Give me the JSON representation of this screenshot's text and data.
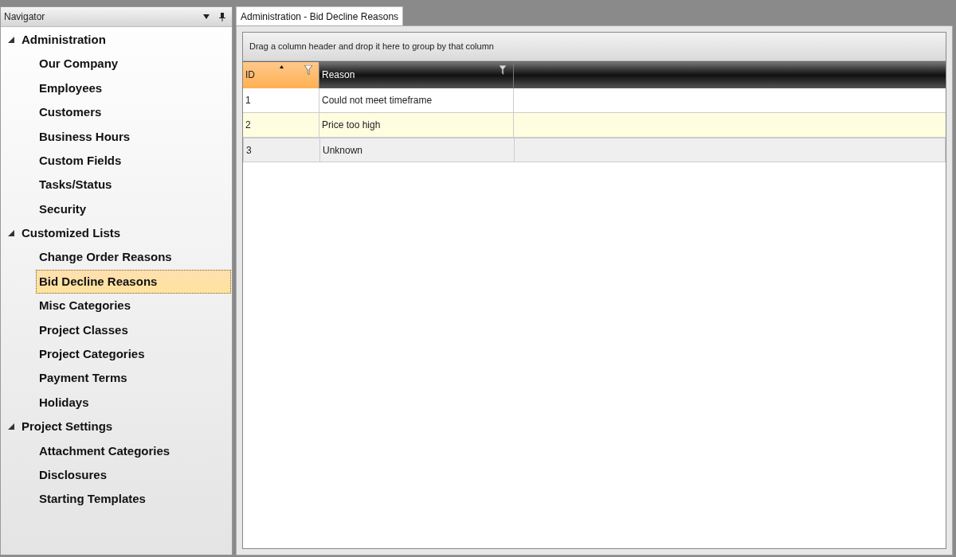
{
  "navigator": {
    "title": "Navigator",
    "groups": [
      {
        "label": "Administration",
        "expanded": true,
        "children": [
          {
            "label": "Our Company",
            "selected": false
          },
          {
            "label": "Employees",
            "selected": false
          },
          {
            "label": "Customers",
            "selected": false
          },
          {
            "label": "Business Hours",
            "selected": false
          },
          {
            "label": "Custom Fields",
            "selected": false
          },
          {
            "label": "Tasks/Status",
            "selected": false
          },
          {
            "label": "Security",
            "selected": false
          }
        ]
      },
      {
        "label": "Customized Lists",
        "expanded": true,
        "children": [
          {
            "label": "Change Order Reasons",
            "selected": false
          },
          {
            "label": "Bid Decline Reasons",
            "selected": true
          },
          {
            "label": "Misc Categories",
            "selected": false
          },
          {
            "label": "Project Classes",
            "selected": false
          },
          {
            "label": "Project Categories",
            "selected": false
          },
          {
            "label": "Payment Terms",
            "selected": false
          },
          {
            "label": "Holidays",
            "selected": false
          }
        ]
      },
      {
        "label": "Project Settings",
        "expanded": true,
        "children": [
          {
            "label": "Attachment Categories",
            "selected": false
          },
          {
            "label": "Disclosures",
            "selected": false
          },
          {
            "label": "Starting Templates",
            "selected": false
          }
        ]
      }
    ]
  },
  "tabs": [
    {
      "label": "Administration - Bid Decline Reasons",
      "selected": true
    }
  ],
  "grid": {
    "group_panel": "Drag a column header and drop it here to group by that column",
    "columns": [
      {
        "label": "ID",
        "sorted": true
      },
      {
        "label": "Reason",
        "sorted": false
      }
    ],
    "rows": [
      {
        "cells": [
          "1",
          "Could not meet timeframe"
        ],
        "hovered": false,
        "selected": false
      },
      {
        "cells": [
          "2",
          "Price too high"
        ],
        "hovered": true,
        "selected": false
      },
      {
        "cells": [
          "3",
          "Unknown"
        ],
        "hovered": false,
        "selected": true
      }
    ]
  }
}
